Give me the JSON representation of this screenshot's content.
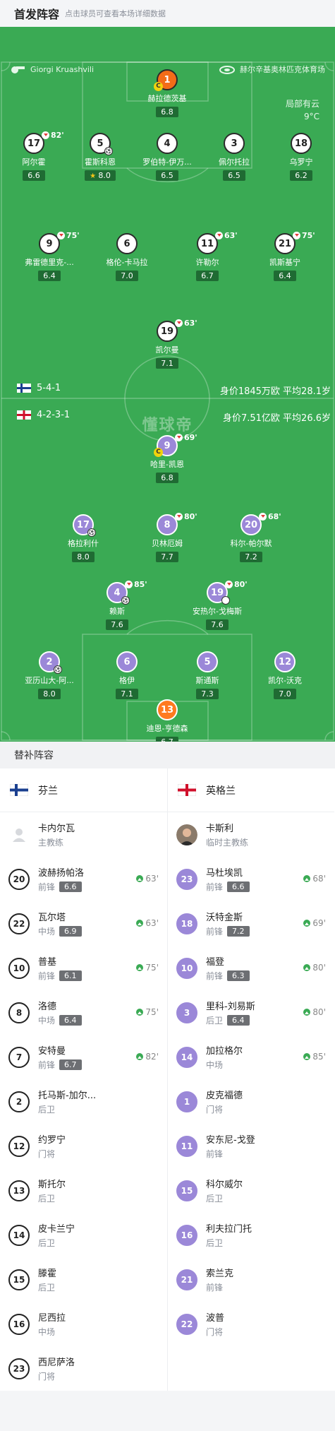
{
  "header": {
    "title": "首发阵容",
    "subtitle": "点击球员可查看本场详细数据"
  },
  "pitch_info": {
    "referee": "Giorgi Kruashvili",
    "venue": "赫尔辛基奥林匹克体育场",
    "weather": "局部有云",
    "temperature": "9°C",
    "watermark": "懂球帝"
  },
  "home": {
    "formation": "5-4-1",
    "value": "身价1845万欧  平均28.1岁",
    "players": [
      {
        "num": "1",
        "name": "赫拉德茨基",
        "rating": "6.8",
        "captain": true
      },
      {
        "num": "17",
        "name": "阿尔霍",
        "rating": "6.6",
        "sub": "82'"
      },
      {
        "num": "5",
        "name": "霍斯科恩",
        "rating": "8.0",
        "goal": true,
        "star": true
      },
      {
        "num": "4",
        "name": "罗伯特-伊万...",
        "rating": "6.5"
      },
      {
        "num": "3",
        "name": "佩尔托拉",
        "rating": "6.5"
      },
      {
        "num": "18",
        "name": "乌罗宁",
        "rating": "6.2"
      },
      {
        "num": "9",
        "name": "弗雷德里克-...",
        "rating": "6.4",
        "sub": "75'"
      },
      {
        "num": "6",
        "name": "格伦-卡马拉",
        "rating": "7.0"
      },
      {
        "num": "11",
        "name": "许勒尔",
        "rating": "6.7",
        "sub": "63'"
      },
      {
        "num": "21",
        "name": "凯斯基宁",
        "rating": "6.4",
        "sub": "75'"
      },
      {
        "num": "19",
        "name": "凯尔曼",
        "rating": "7.1",
        "sub": "63'"
      }
    ]
  },
  "away": {
    "formation": "4-2-3-1",
    "value": "身价7.51亿欧  平均26.6岁",
    "players": [
      {
        "num": "9",
        "name": "哈里-凯恩",
        "rating": "6.8",
        "captain": true,
        "sub": "69'"
      },
      {
        "num": "17",
        "name": "格拉利什",
        "rating": "8.0",
        "goal": true
      },
      {
        "num": "8",
        "name": "贝林厄姆",
        "rating": "7.7",
        "sub": "80'"
      },
      {
        "num": "20",
        "name": "科尔-帕尔默",
        "rating": "7.2",
        "sub": "68'"
      },
      {
        "num": "4",
        "name": "赖斯",
        "rating": "7.6",
        "sub": "85'",
        "goal": true
      },
      {
        "num": "19",
        "name": "安热尔-戈梅斯",
        "rating": "7.6",
        "sub": "80'",
        "assist": true
      },
      {
        "num": "2",
        "name": "亚历山大-阿...",
        "rating": "8.0",
        "goal": true
      },
      {
        "num": "6",
        "name": "格伊",
        "rating": "7.1"
      },
      {
        "num": "5",
        "name": "斯通斯",
        "rating": "7.3"
      },
      {
        "num": "12",
        "name": "凯尔-沃克",
        "rating": "7.0"
      },
      {
        "num": "13",
        "name": "迪恩-亨德森",
        "rating": "6.7"
      }
    ]
  },
  "subs": {
    "title": "替补阵容",
    "home_team": "芬兰",
    "away_team": "英格兰",
    "home_coach": {
      "name": "卡内尔瓦",
      "role": "主教练"
    },
    "away_coach": {
      "name": "卡斯利",
      "role": "临时主教练"
    },
    "home": [
      {
        "num": "20",
        "name": "波赫扬帕洛",
        "pos": "前锋",
        "rating": "6.6",
        "in": "63'"
      },
      {
        "num": "22",
        "name": "瓦尔塔",
        "pos": "中场",
        "rating": "6.9",
        "in": "63'"
      },
      {
        "num": "10",
        "name": "普基",
        "pos": "前锋",
        "rating": "6.1",
        "in": "75'"
      },
      {
        "num": "8",
        "name": "洛德",
        "pos": "中场",
        "rating": "6.4",
        "in": "75'"
      },
      {
        "num": "7",
        "name": "安特曼",
        "pos": "前锋",
        "rating": "6.7",
        "in": "82'"
      },
      {
        "num": "2",
        "name": "托马斯-加尔...",
        "pos": "后卫"
      },
      {
        "num": "12",
        "name": "约罗宁",
        "pos": "门将"
      },
      {
        "num": "13",
        "name": "斯托尔",
        "pos": "后卫"
      },
      {
        "num": "14",
        "name": "皮卡兰宁",
        "pos": "后卫"
      },
      {
        "num": "15",
        "name": "滕霍",
        "pos": "后卫"
      },
      {
        "num": "16",
        "name": "尼西拉",
        "pos": "中场"
      },
      {
        "num": "23",
        "name": "西尼萨洛",
        "pos": "门将"
      }
    ],
    "away": [
      {
        "num": "23",
        "name": "马杜埃凯",
        "pos": "前锋",
        "rating": "6.6",
        "in": "68'"
      },
      {
        "num": "18",
        "name": "沃特金斯",
        "pos": "前锋",
        "rating": "7.2",
        "in": "69'"
      },
      {
        "num": "10",
        "name": "福登",
        "pos": "前锋",
        "rating": "6.3",
        "in": "80'"
      },
      {
        "num": "3",
        "name": "里科-刘易斯",
        "pos": "后卫",
        "rating": "6.4",
        "in": "80'"
      },
      {
        "num": "14",
        "name": "加拉格尔",
        "pos": "中场",
        "in": "85'"
      },
      {
        "num": "1",
        "name": "皮克福德",
        "pos": "门将"
      },
      {
        "num": "11",
        "name": "安东尼-戈登",
        "pos": "前锋"
      },
      {
        "num": "15",
        "name": "科尔威尔",
        "pos": "后卫"
      },
      {
        "num": "16",
        "name": "利夫拉门托",
        "pos": "后卫"
      },
      {
        "num": "21",
        "name": "索兰克",
        "pos": "前锋"
      },
      {
        "num": "22",
        "name": "波普",
        "pos": "门将"
      }
    ]
  },
  "colors": {
    "pitch": "#3aaa54",
    "home_kit": "#ffffff",
    "home_gk": "#f36c18",
    "away_kit": "#9b88d8",
    "away_gk": "#ff7a1f"
  }
}
